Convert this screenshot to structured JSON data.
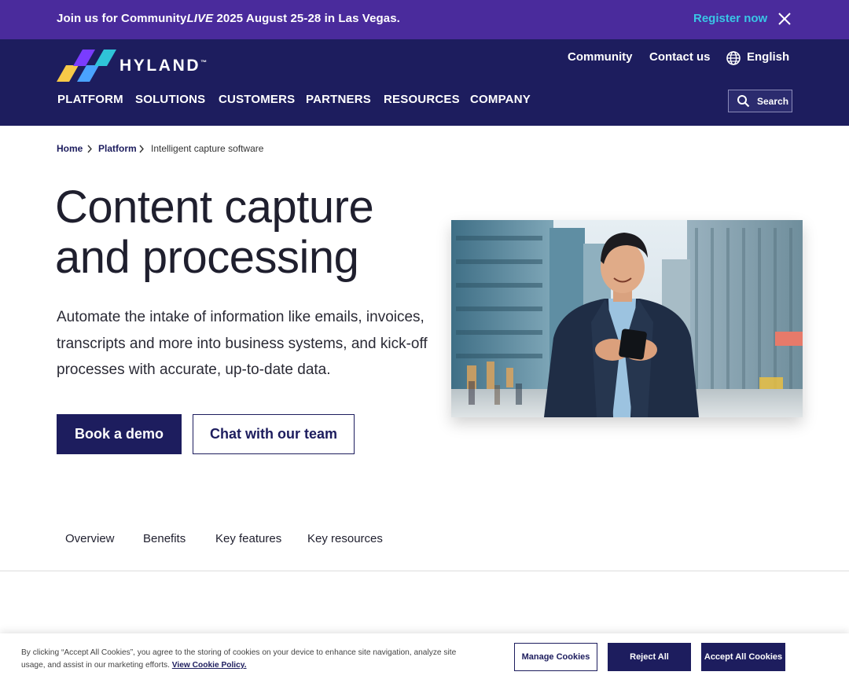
{
  "announcement": {
    "prefix": "Join us for Community",
    "italic": "LIVE",
    "suffix": " 2025 August 25-28 in Las Vegas.",
    "register_label": "Register now"
  },
  "brand": {
    "name": "HYLAND",
    "trademark": "™",
    "colors": {
      "header_bg": "#1d1d5e",
      "announce_bg": "#4a2b9c",
      "accent_cyan": "#39c6e6",
      "logo_yellow": "#f7c948",
      "logo_blue": "#4aa3ff",
      "logo_purple": "#7a3cff"
    }
  },
  "utility_nav": {
    "community": "Community",
    "contact": "Contact us",
    "language": "English"
  },
  "main_nav": {
    "items": [
      {
        "label": "PLATFORM"
      },
      {
        "label": "SOLUTIONS"
      },
      {
        "label": "CUSTOMERS"
      },
      {
        "label": "PARTNERS"
      },
      {
        "label": "RESOURCES"
      },
      {
        "label": "COMPANY"
      }
    ],
    "search_label": "Search"
  },
  "breadcrumb": {
    "items": [
      {
        "label": "Home"
      },
      {
        "label": "Platform"
      },
      {
        "label": "Intelligent capture software"
      }
    ]
  },
  "hero": {
    "title_lines": [
      "Content capture",
      "and processing"
    ],
    "description_lines": [
      "Automate the intake of information like emails, invoices,",
      "transcripts and more into business systems, and kick-off",
      "processes with accurate, up-to-date data."
    ],
    "primary_cta": "Book a demo",
    "secondary_cta": "Chat with our team",
    "image_icon": "businessman-with-phone-photo"
  },
  "section_tabs": {
    "items": [
      {
        "label": "Overview"
      },
      {
        "label": "Benefits"
      },
      {
        "label": "Key features"
      },
      {
        "label": "Key resources"
      }
    ]
  },
  "cookie_banner": {
    "text_line1": "By clicking “Accept All Cookies”, you agree to the storing of cookies on your device to enhance site navigation, analyze site",
    "text_line2": "usage, and assist in our marketing efforts.",
    "policy_link": "View Cookie Policy.",
    "manage_label": "Manage Cookies",
    "reject_label": "Reject All",
    "accept_label": "Accept All Cookies"
  }
}
